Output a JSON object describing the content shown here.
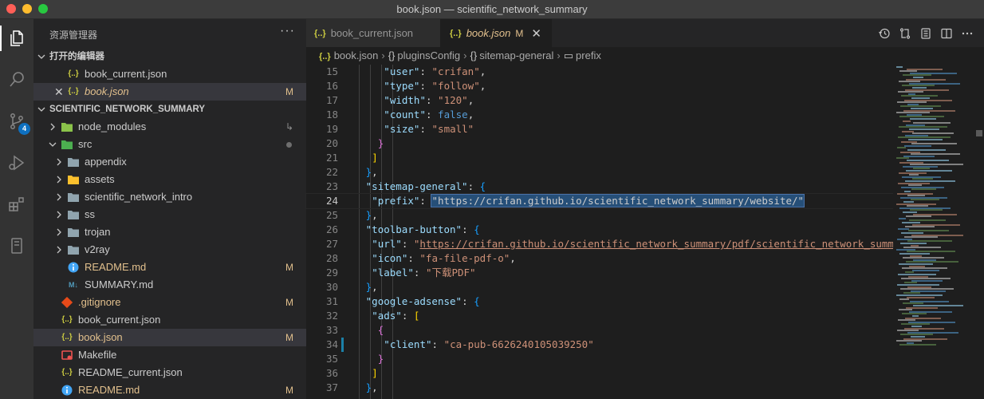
{
  "window": {
    "title": "book.json — scientific_network_summary"
  },
  "activity_bar": {
    "items": [
      {
        "name": "explorer-icon"
      },
      {
        "name": "search-icon"
      },
      {
        "name": "source-control-icon",
        "badge": "4"
      },
      {
        "name": "run-debug-icon"
      },
      {
        "name": "extensions-icon"
      },
      {
        "name": "remote-explorer-icon"
      }
    ]
  },
  "sidebar": {
    "title": "资源管理器",
    "more": "···",
    "open_editors": {
      "label": "打开的编辑器",
      "items": [
        {
          "icon": "{..}",
          "label": "book_current.json"
        },
        {
          "icon": "{..}",
          "label": "book.json",
          "status": "M"
        }
      ]
    },
    "workspace": {
      "label": "SCIENTIFIC_NETWORK_SUMMARY",
      "items": [
        {
          "label": "node_modules",
          "type": "folder"
        },
        {
          "label": "src",
          "type": "folder-open"
        },
        {
          "label": "appendix",
          "type": "folder"
        },
        {
          "label": "assets",
          "type": "folder"
        },
        {
          "label": "scientific_network_intro",
          "type": "folder"
        },
        {
          "label": "ss",
          "type": "folder"
        },
        {
          "label": "trojan",
          "type": "folder"
        },
        {
          "label": "v2ray",
          "type": "folder"
        },
        {
          "label": "README.md",
          "status": "M"
        },
        {
          "label": "SUMMARY.md"
        },
        {
          "label": ".gitignore",
          "status": "M"
        },
        {
          "label": "book_current.json"
        },
        {
          "label": "book.json",
          "status": "M"
        },
        {
          "label": "Makefile"
        },
        {
          "label": "README_current.json"
        },
        {
          "label": "README.md",
          "status": "M"
        }
      ]
    }
  },
  "tabs": [
    {
      "label": "book_current.json",
      "icon": "{..}"
    },
    {
      "label": "book.json",
      "icon": "{..}",
      "status": "M",
      "close": "✕"
    }
  ],
  "breadcrumb": {
    "file": "book.json",
    "parts": [
      "pluginsConfig",
      "sitemap-general",
      "prefix"
    ]
  },
  "code": {
    "lines": [
      {
        "n": "15",
        "t": [
          [
            "k",
            "\"user\""
          ],
          [
            "p",
            ": "
          ],
          [
            "s",
            "\"crifan\""
          ],
          [
            "p",
            ","
          ]
        ]
      },
      {
        "n": "16",
        "t": [
          [
            "k",
            "\"type\""
          ],
          [
            "p",
            ": "
          ],
          [
            "s",
            "\"follow\""
          ],
          [
            "p",
            ","
          ]
        ]
      },
      {
        "n": "17",
        "t": [
          [
            "k",
            "\"width\""
          ],
          [
            "p",
            ": "
          ],
          [
            "s",
            "\"120\""
          ],
          [
            "p",
            ","
          ]
        ]
      },
      {
        "n": "18",
        "t": [
          [
            "k",
            "\"count\""
          ],
          [
            "p",
            ": "
          ],
          [
            "b",
            "false"
          ],
          [
            "p",
            ","
          ]
        ]
      },
      {
        "n": "19",
        "t": [
          [
            "k",
            "\"size\""
          ],
          [
            "p",
            ": "
          ],
          [
            "s",
            "\"small\""
          ]
        ]
      },
      {
        "n": "20",
        "t": [
          [
            "br2",
            "}"
          ]
        ]
      },
      {
        "n": "21",
        "t": [
          [
            "br1",
            "]"
          ]
        ]
      },
      {
        "n": "22",
        "t": [
          [
            "br3",
            "}"
          ],
          [
            "p",
            ","
          ]
        ]
      },
      {
        "n": "23",
        "t": [
          [
            "k",
            "\"sitemap-general\""
          ],
          [
            "p",
            ": "
          ],
          [
            "br3",
            "{"
          ]
        ]
      },
      {
        "n": "24",
        "t": [
          [
            "k",
            "\"prefix\""
          ],
          [
            "p",
            ": "
          ],
          [
            "sel",
            "\"https://crifan.github.io/scientific_network_summary/website/\""
          ]
        ]
      },
      {
        "n": "25",
        "t": [
          [
            "br3",
            "}"
          ],
          [
            "p",
            ","
          ]
        ]
      },
      {
        "n": "26",
        "t": [
          [
            "k",
            "\"toolbar-button\""
          ],
          [
            "p",
            ": "
          ],
          [
            "br3",
            "{"
          ]
        ]
      },
      {
        "n": "27",
        "t": [
          [
            "k",
            "\"url\""
          ],
          [
            "p",
            ": "
          ],
          [
            "s",
            "\""
          ],
          [
            "url",
            "https://crifan.github.io/scientific_network_summary/pdf/scientific_network_summ"
          ]
        ]
      },
      {
        "n": "28",
        "t": [
          [
            "k",
            "\"icon\""
          ],
          [
            "p",
            ": "
          ],
          [
            "s",
            "\"fa-file-pdf-o\""
          ],
          [
            "p",
            ","
          ]
        ]
      },
      {
        "n": "29",
        "t": [
          [
            "k",
            "\"label\""
          ],
          [
            "p",
            ": "
          ],
          [
            "s",
            "\"下载PDF\""
          ]
        ]
      },
      {
        "n": "30",
        "t": [
          [
            "br3",
            "}"
          ],
          [
            "p",
            ","
          ]
        ]
      },
      {
        "n": "31",
        "t": [
          [
            "k",
            "\"google-adsense\""
          ],
          [
            "p",
            ": "
          ],
          [
            "br3",
            "{"
          ]
        ]
      },
      {
        "n": "32",
        "t": [
          [
            "k",
            "\"ads\""
          ],
          [
            "p",
            ": "
          ],
          [
            "br1",
            "["
          ]
        ]
      },
      {
        "n": "33",
        "t": [
          [
            "br2",
            "{"
          ]
        ]
      },
      {
        "n": "34",
        "t": [
          [
            "k",
            "\"client\""
          ],
          [
            "p",
            ": "
          ],
          [
            "s",
            "\"ca-pub-6626240105039250\""
          ]
        ]
      },
      {
        "n": "35",
        "t": [
          [
            "br2",
            "}"
          ]
        ]
      },
      {
        "n": "36",
        "t": [
          [
            "br1",
            "]"
          ]
        ]
      },
      {
        "n": "37",
        "t": [
          [
            "br3",
            "}"
          ],
          [
            "p",
            ","
          ]
        ]
      }
    ],
    "current_line": "24",
    "modified_line": "34"
  },
  "colors": {
    "accent": "#0e70c0",
    "modified": "#e2c08d",
    "selection": "#264f78"
  }
}
